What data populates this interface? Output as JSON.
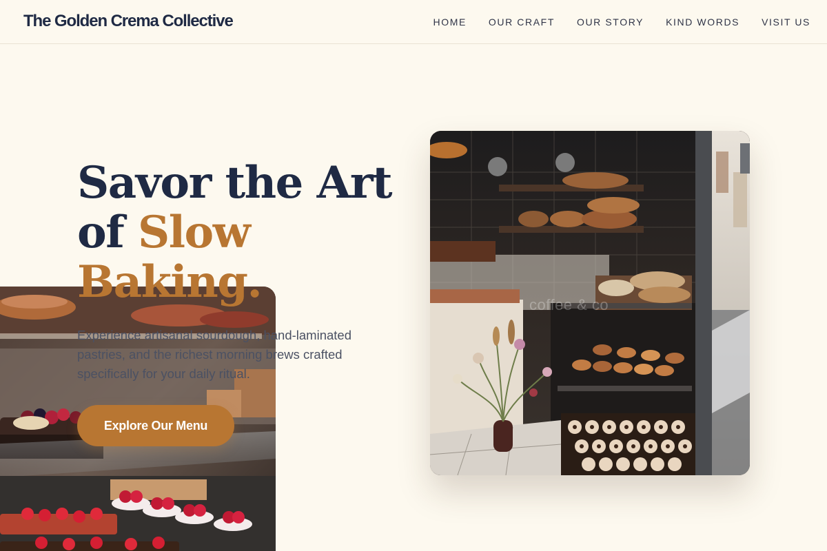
{
  "site": {
    "brand": "The Golden Crema Collective"
  },
  "nav": {
    "items": [
      "HOME",
      "OUR CRAFT",
      "OUR STORY",
      "KIND WORDS",
      "VISIT US"
    ]
  },
  "hero": {
    "headline_line1": "Savor the Art",
    "headline_of": "of",
    "headline_accent": "Slow Baking.",
    "subtext": "Experience artisanal sourdough, hand-laminated pastries, and the richest morning brews crafted specifically for your daily ritual.",
    "cta_label": "Explore Our Menu"
  },
  "photos": {
    "right_caption": "coffee & co"
  },
  "colors": {
    "background": "#fdf9ef",
    "navy": "#1f2a44",
    "accent": "#b87632"
  }
}
